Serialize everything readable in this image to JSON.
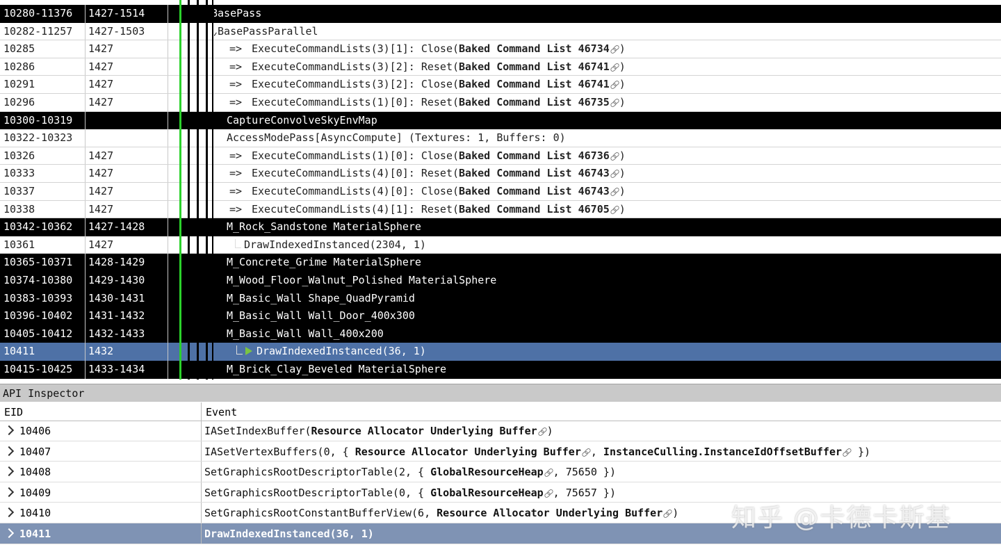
{
  "event_rows": [
    {
      "eid": "10280-11376",
      "dur": "1427-1514",
      "style": "dark",
      "indent": 0,
      "text": "BasePass"
    },
    {
      "eid": "10282-11257",
      "dur": "1427-1503",
      "style": "light",
      "indent": 0,
      "text": "⌄BasePassParallel"
    },
    {
      "eid": "10285",
      "dur": "1427",
      "style": "light",
      "indent": 2,
      "arrow": "=>",
      "text": "ExecuteCommandLists(3)[1]:  Close(",
      "bold": "Baked Command List 46734",
      "tail": ")"
    },
    {
      "eid": "10286",
      "dur": "1427",
      "style": "light",
      "indent": 2,
      "arrow": "=>",
      "text": "ExecuteCommandLists(3)[2]:  Reset(",
      "bold": "Baked Command List 46741",
      "tail": ")"
    },
    {
      "eid": "10291",
      "dur": "1427",
      "style": "light",
      "indent": 2,
      "arrow": "=>",
      "text": "ExecuteCommandLists(3)[2]:  Close(",
      "bold": "Baked Command List 46741",
      "tail": ")"
    },
    {
      "eid": "10296",
      "dur": "1427",
      "style": "light",
      "indent": 2,
      "arrow": "=>",
      "text": "ExecuteCommandLists(1)[0]:  Reset(",
      "bold": "Baked Command List 46735",
      "tail": ")"
    },
    {
      "eid": "10300-10319",
      "dur": "",
      "style": "dark",
      "indent": 1,
      "text": "CaptureConvolveSkyEnvMap"
    },
    {
      "eid": "10322-10323",
      "dur": "",
      "style": "light",
      "indent": 1,
      "text": "AccessModePass[AsyncCompute] (Textures: 1, Buffers: 0)"
    },
    {
      "eid": "10326",
      "dur": "1427",
      "style": "light",
      "indent": 2,
      "arrow": "=>",
      "text": "ExecuteCommandLists(1)[0]:  Close(",
      "bold": "Baked Command List 46736",
      "tail": ")"
    },
    {
      "eid": "10333",
      "dur": "1427",
      "style": "light",
      "indent": 2,
      "arrow": "=>",
      "text": "ExecuteCommandLists(4)[0]:  Reset(",
      "bold": "Baked Command List 46743",
      "tail": ")"
    },
    {
      "eid": "10337",
      "dur": "1427",
      "style": "light",
      "indent": 2,
      "arrow": "=>",
      "text": "ExecuteCommandLists(4)[0]:  Close(",
      "bold": "Baked Command List 46743",
      "tail": ")"
    },
    {
      "eid": "10338",
      "dur": "1427",
      "style": "light",
      "indent": 2,
      "arrow": "=>",
      "text": "ExecuteCommandLists(4)[1]:  Reset(",
      "bold": "Baked Command List 46705",
      "tail": ")"
    },
    {
      "eid": "10342-10362",
      "dur": "1427-1428",
      "style": "dark",
      "indent": 1,
      "text": "M_Rock_Sandstone MaterialSphere"
    },
    {
      "eid": "10361",
      "dur": "1427",
      "style": "light",
      "indent": 3,
      "text": "DrawIndexedInstanced(2304, 1)"
    },
    {
      "eid": "10365-10371",
      "dur": "1428-1429",
      "style": "dark",
      "indent": 1,
      "text": "M_Concrete_Grime MaterialSphere"
    },
    {
      "eid": "10374-10380",
      "dur": "1429-1430",
      "style": "dark",
      "indent": 1,
      "text": "M_Wood_Floor_Walnut_Polished MaterialSphere"
    },
    {
      "eid": "10383-10393",
      "dur": "1430-1431",
      "style": "dark",
      "indent": 1,
      "text": "M_Basic_Wall Shape_QuadPyramid"
    },
    {
      "eid": "10396-10402",
      "dur": "1431-1432",
      "style": "dark",
      "indent": 1,
      "text": "M_Basic_Wall Wall_Door_400x300"
    },
    {
      "eid": "10405-10412",
      "dur": "1432-1433",
      "style": "dark",
      "indent": 1,
      "text": "M_Basic_Wall Wall_400x200"
    },
    {
      "eid": "10411",
      "dur": "1432",
      "style": "sel",
      "indent": 4,
      "flag": true,
      "text": "DrawIndexedInstanced(36, 1)"
    },
    {
      "eid": "10415-10425",
      "dur": "1433-1434",
      "style": "dark",
      "indent": 1,
      "text": "M_Brick_Clay_Beveled MaterialSphere"
    }
  ],
  "api_inspector": {
    "title": "API Inspector",
    "col_eid": "EID",
    "col_event": "Event",
    "rows": [
      {
        "eid": "10406",
        "parts": [
          {
            "t": "IASetIndexBuffer("
          },
          {
            "b": "Resource Allocator Underlying Buffer",
            "link": true
          },
          {
            "t": ")"
          }
        ]
      },
      {
        "eid": "10407",
        "parts": [
          {
            "t": "IASetVertexBuffers(0,  {  "
          },
          {
            "b": "Resource Allocator Underlying Buffer",
            "link": true
          },
          {
            "t": ",  "
          },
          {
            "b": "InstanceCulling.InstanceIdOffsetBuffer",
            "link": true
          },
          {
            "t": "  })"
          }
        ]
      },
      {
        "eid": "10408",
        "parts": [
          {
            "t": "SetGraphicsRootDescriptorTable(2,  {  "
          },
          {
            "b": "GlobalResourceHeap",
            "link": true
          },
          {
            "t": ",  75650  })"
          }
        ]
      },
      {
        "eid": "10409",
        "parts": [
          {
            "t": "SetGraphicsRootDescriptorTable(0,  {  "
          },
          {
            "b": "GlobalResourceHeap",
            "link": true
          },
          {
            "t": ",  75657  })"
          }
        ]
      },
      {
        "eid": "10410",
        "parts": [
          {
            "t": "SetGraphicsRootConstantBufferView(6,  "
          },
          {
            "b": "Resource Allocator Underlying Buffer",
            "link": true
          },
          {
            "t": ")"
          }
        ]
      },
      {
        "eid": "10411",
        "selected": true,
        "parts": [
          {
            "t": "DrawIndexedInstanced(36, 1)"
          }
        ]
      }
    ]
  },
  "watermark": "知乎 @卡德卡斯基",
  "colors": {
    "selected_row": "#4e71a6",
    "api_selected": "#7f93b4",
    "timeline_green": "#2bd12b"
  }
}
